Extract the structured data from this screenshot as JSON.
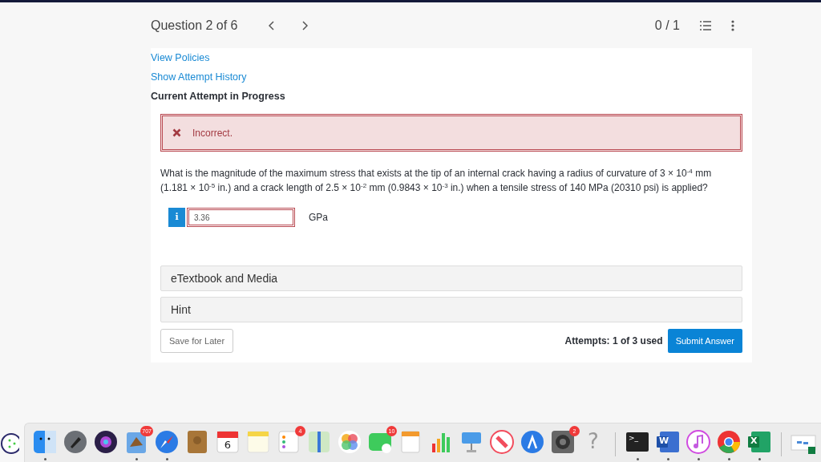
{
  "header": {
    "title": "Question 2 of 6",
    "score": "0 / 1"
  },
  "links": [
    "View Policies",
    "Show Attempt History"
  ],
  "attempt_heading": "Current Attempt in Progress",
  "feedback": {
    "kind": "incorrect",
    "text": "Incorrect."
  },
  "question": "What is the magnitude of the maximum stress that exists at the tip of an internal crack having a radius of curvature of 3 × 10$^{-4}$ mm (1.181 × 10$^{-5}$ in.) and a crack length of 2.5 × 10$^{-2}$ mm (0.9843 × 10$^{-3}$ in.) when a tensile stress of 140 MPa (20310 psi) is applied?",
  "answer": {
    "info": "i",
    "value": "3.36",
    "unit": "GPa",
    "invalid": true
  },
  "sections": [
    {
      "label": "eTextbook and Media",
      "expanded": false
    },
    {
      "label": "Hint",
      "expanded": false
    }
  ],
  "save_button": "Save for Later",
  "attempts": "Attempts: 1 of 3 used",
  "submit_button": "Submit Answer",
  "dock": [
    {
      "kind": "finder",
      "running": true
    },
    {
      "kind": "launchpad",
      "running": false
    },
    {
      "kind": "siri",
      "running": false
    },
    {
      "kind": "mail",
      "running": true,
      "badge": "707"
    },
    {
      "kind": "safari",
      "running": true
    },
    {
      "kind": "contacts",
      "running": false
    },
    {
      "kind": "calendar",
      "running": false,
      "label": "6"
    },
    {
      "kind": "notes",
      "running": false
    },
    {
      "kind": "reminders",
      "running": false,
      "badge": "4"
    },
    {
      "kind": "maps",
      "running": false
    },
    {
      "kind": "photos",
      "running": false
    },
    {
      "kind": "facetime",
      "running": false,
      "badge": "10"
    },
    {
      "kind": "pages",
      "running": false
    },
    {
      "kind": "numbers",
      "running": false
    },
    {
      "kind": "keynote",
      "running": false
    },
    {
      "kind": "news",
      "running": false
    },
    {
      "kind": "appstore",
      "running": false
    },
    {
      "kind": "settings",
      "running": false,
      "badge": "2"
    },
    {
      "kind": "help",
      "running": false,
      "label": "?"
    },
    {
      "kind": "separator"
    },
    {
      "kind": "terminal",
      "running": true,
      "label": ">_"
    },
    {
      "kind": "word",
      "running": true,
      "label": "W"
    },
    {
      "kind": "music",
      "running": true
    },
    {
      "kind": "chrome",
      "running": true
    },
    {
      "kind": "excel",
      "running": true,
      "label": "X"
    },
    {
      "kind": "separator"
    },
    {
      "kind": "window",
      "running": false
    }
  ]
}
